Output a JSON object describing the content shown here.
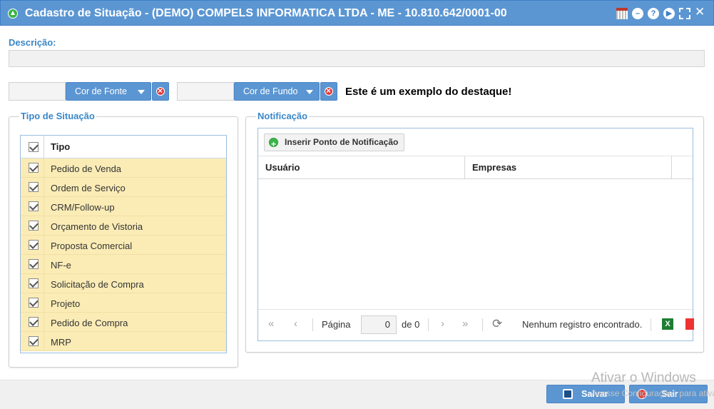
{
  "window": {
    "title": "Cadastro de Situação - (DEMO) COMPELS INFORMATICA LTDA - ME - 10.810.642/0001-00"
  },
  "form": {
    "description_label": "Descrição:",
    "description_value": "",
    "font_color_button": "Cor de Fonte",
    "bg_color_button": "Cor de Fundo",
    "example_text": "Este é um exemplo do destaque!"
  },
  "tipo_situacao": {
    "legend": "Tipo de Situação",
    "column_header": "Tipo",
    "items": [
      "Pedido de Venda",
      "Ordem de Serviço",
      "CRM/Follow-up",
      "Orçamento de Vistoria",
      "Proposta Comercial",
      "NF-e",
      "Solicitação de Compra",
      "Projeto",
      "Pedido de Compra",
      "MRP"
    ]
  },
  "notificacao": {
    "legend": "Notificação",
    "insert_button": "Inserir Ponto de Notificação",
    "columns": [
      "Usuário",
      "Empresas"
    ],
    "pager": {
      "page_label": "Página",
      "page_value": "0",
      "of_label": "de 0",
      "status": "Nenhum registro encontrado."
    }
  },
  "footer": {
    "save_button": "Salvar",
    "exit_button": "Sair"
  },
  "watermark": {
    "line1": "Ativar o Windows",
    "line2": "Acesse Configurações para ativar o Windows."
  }
}
